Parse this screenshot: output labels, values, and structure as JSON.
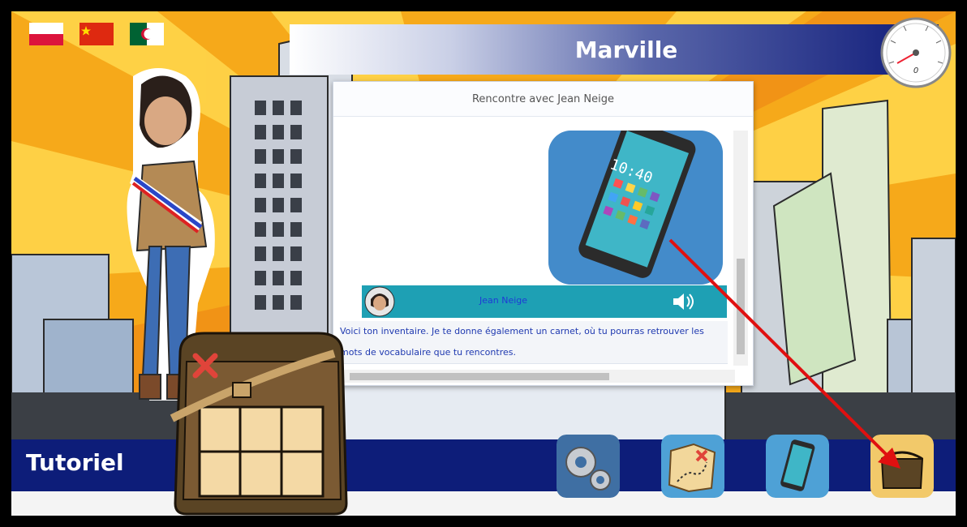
{
  "flags": [
    {
      "name": "poland-flag"
    },
    {
      "name": "china-flag"
    },
    {
      "name": "algeria-flag"
    }
  ],
  "header": {
    "title": "Marville"
  },
  "dialog": {
    "title": "Rencontre avec Jean Neige",
    "speaker": "Jean Neige",
    "message": "Voici ton inventaire. Je te donne également un carnet, où tu pourras retrouver les mots de vocabulaire que tu rencontres.",
    "phone_time": "10:40"
  },
  "bottom": {
    "label": "Tutoriel"
  },
  "speedometer": {
    "value": "0"
  },
  "colors": {
    "accent": "#0d1d79",
    "message_bar": "#1ea0b4",
    "arrow": "#e01010",
    "close_x": "#e0443a"
  },
  "toolbar": [
    "settings-gears-icon",
    "treasure-map-icon",
    "phone-icon",
    "bag-inventory-icon"
  ]
}
